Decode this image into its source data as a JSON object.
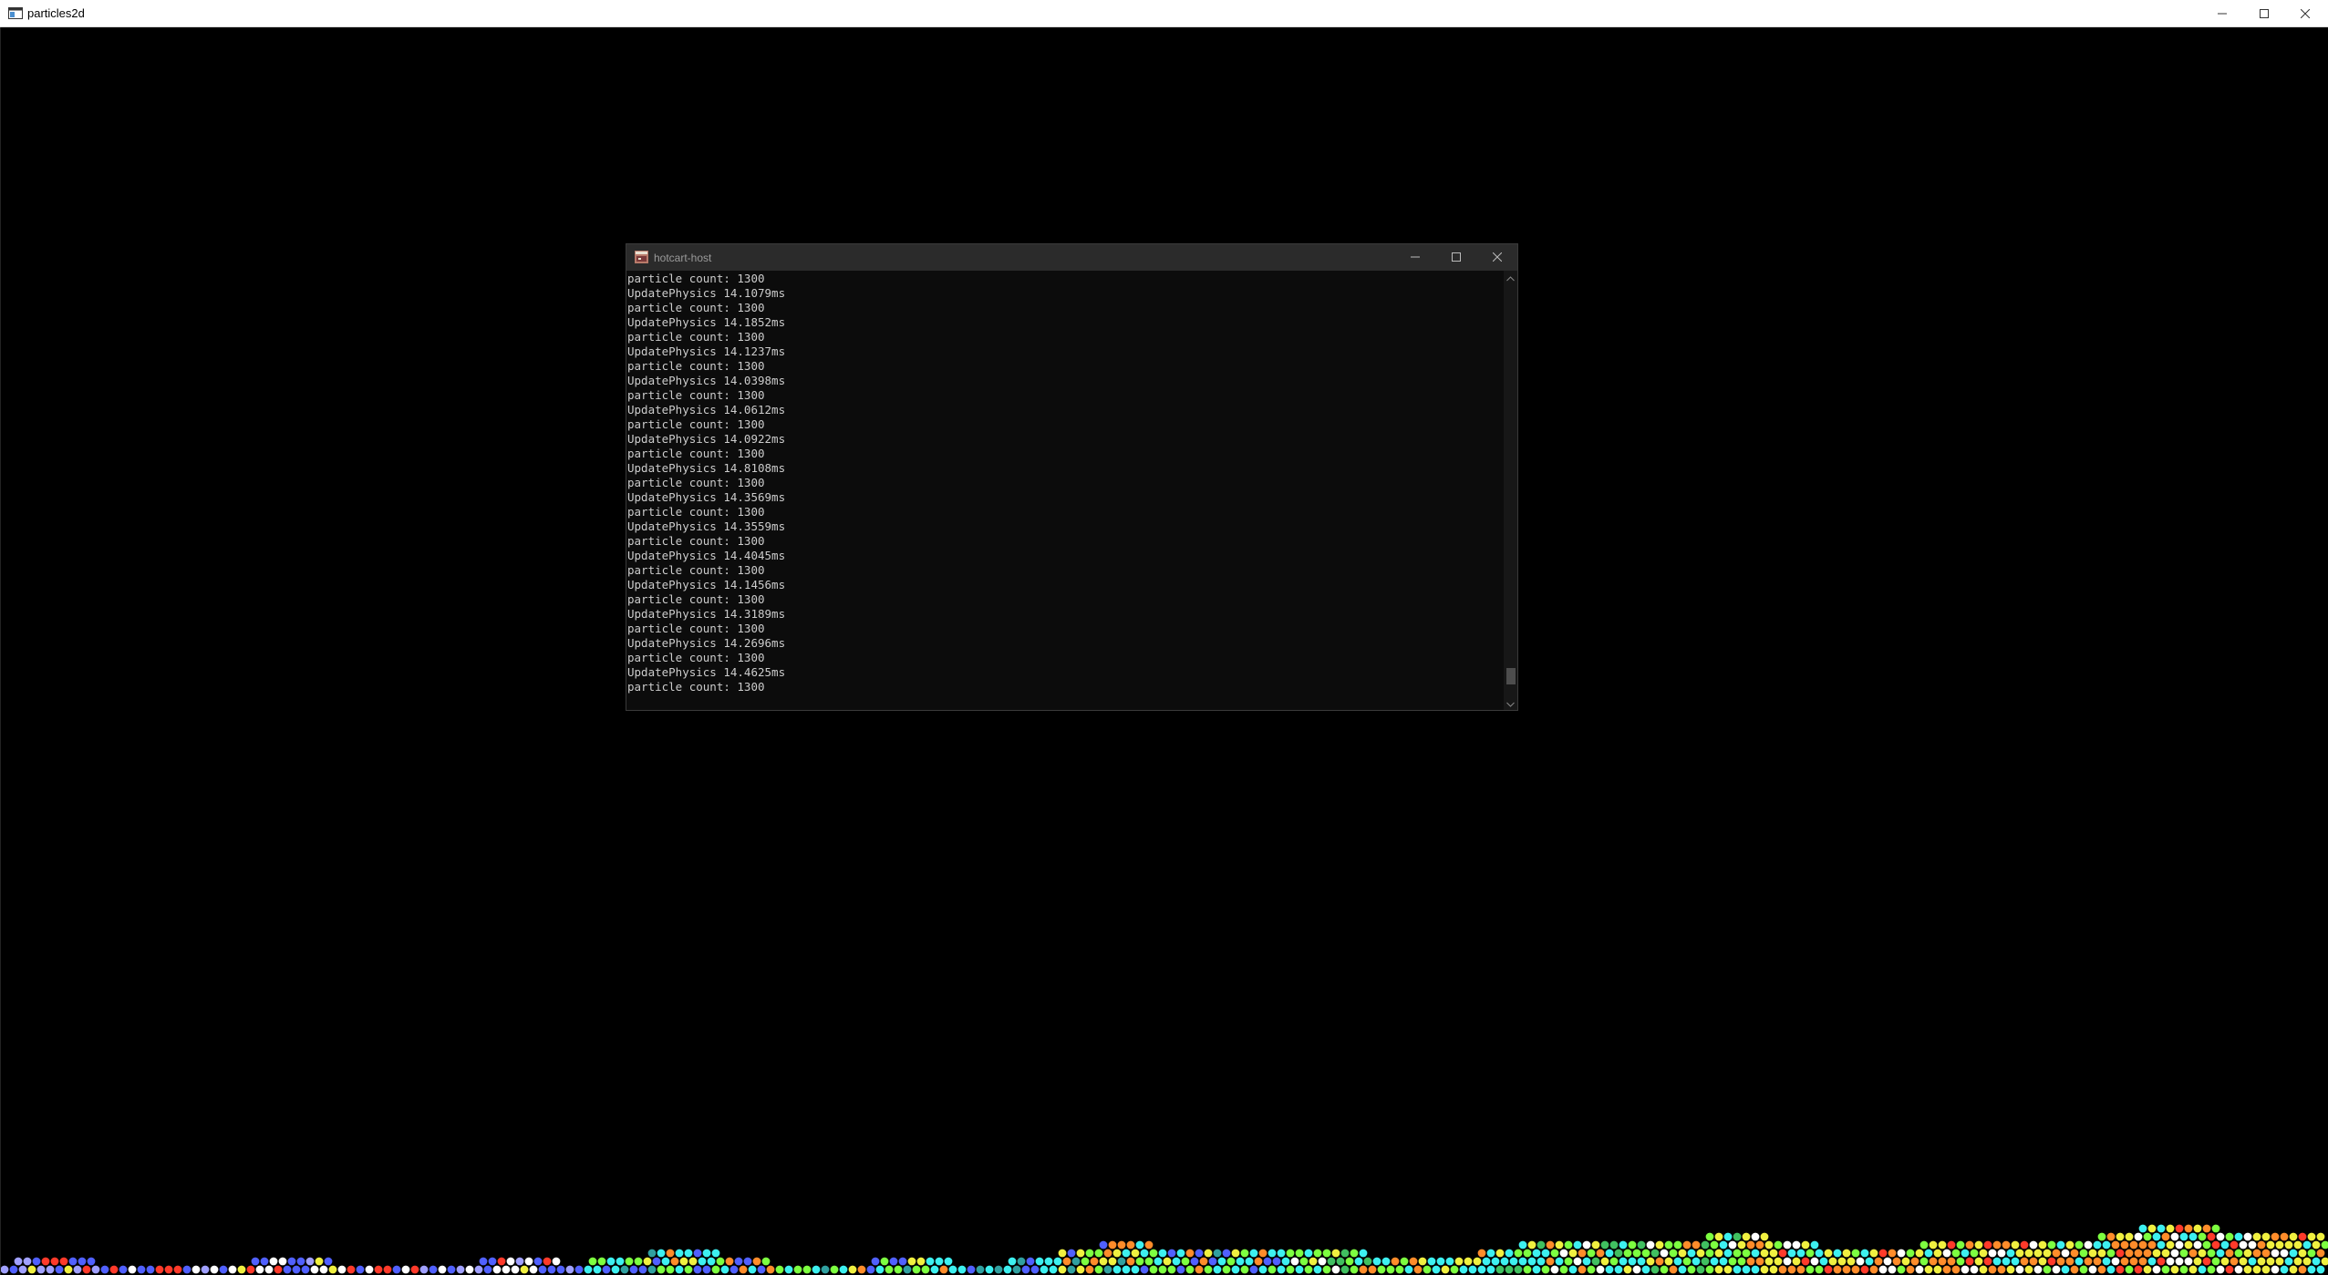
{
  "main_window": {
    "title": "particles2d",
    "icon": "app-window-icon",
    "controls": {
      "minimize_icon": "minimize-icon",
      "maximize_icon": "maximize-icon",
      "close_icon": "close-icon"
    }
  },
  "console_window": {
    "title": "hotcart-host",
    "icon": "console-app-icon",
    "lines": [
      "particle count: 1300",
      "UpdatePhysics 14.1079ms",
      "particle count: 1300",
      "UpdatePhysics 14.1852ms",
      "particle count: 1300",
      "UpdatePhysics 14.1237ms",
      "particle count: 1300",
      "UpdatePhysics 14.0398ms",
      "particle count: 1300",
      "UpdatePhysics 14.0612ms",
      "particle count: 1300",
      "UpdatePhysics 14.0922ms",
      "particle count: 1300",
      "UpdatePhysics 14.8108ms",
      "particle count: 1300",
      "UpdatePhysics 14.3569ms",
      "particle count: 1300",
      "UpdatePhysics 14.3559ms",
      "particle count: 1300",
      "UpdatePhysics 14.4045ms",
      "particle count: 1300",
      "UpdatePhysics 14.1456ms",
      "particle count: 1300",
      "UpdatePhysics 14.3189ms",
      "particle count: 1300",
      "UpdatePhysics 14.2696ms",
      "particle count: 1300",
      "UpdatePhysics 14.4625ms",
      "particle count: 1300"
    ],
    "scroll_position": 0.97
  },
  "colors": {
    "background": "#000000",
    "console_background": "#0c0c0c",
    "console_text": "#cccccc",
    "particle_palette": [
      "#3df0f0",
      "#5060ff",
      "#7dff40",
      "#f0f040",
      "#ff8c2a",
      "#ff3a2a",
      "#ffffff",
      "#30a0a0",
      "#a0a0ff",
      "#40c060"
    ]
  }
}
